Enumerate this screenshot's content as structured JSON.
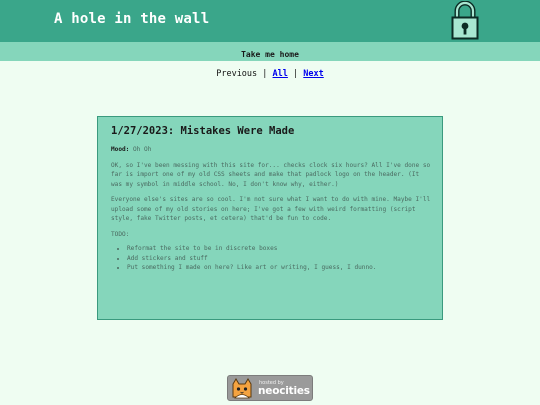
{
  "header": {
    "title": "A hole in the wall",
    "logo_icon": "padlock-icon",
    "bg_color": "#3aa68a"
  },
  "nav": {
    "home_label": "Take me home",
    "bg_color": "#85d6bb"
  },
  "pager": {
    "previous": "Previous",
    "separator": "|",
    "all": "All",
    "next": "Next"
  },
  "post": {
    "title": "1/27/2023: Mistakes Were Made",
    "mood_label": "Mood:",
    "mood_value": "Oh Oh",
    "paragraphs": [
      "OK, so I've been messing with this site for... checks clock six hours? All I've done so far is import one of my old CSS sheets and make that padlock logo on the header. (It was my symbol in middle school. No, I don't know why, either.)",
      "Everyone else's sites are so cool. I'm not sure what I want to do with mine. Maybe I'll upload some of my old stories on here; I've got a few with weird formatting (script style, fake Twitter posts, et cetera) that'd be fun to code.",
      "TODO:"
    ],
    "todo": [
      "Reformat the site to be in discrete boxes",
      "Add stickers and stuff",
      "Put something I made on here? Like art or writing, I guess, I dunno."
    ]
  },
  "badge": {
    "small_text": "hosted by",
    "big_text": "neocities",
    "icon": "neocities-cat-icon"
  }
}
